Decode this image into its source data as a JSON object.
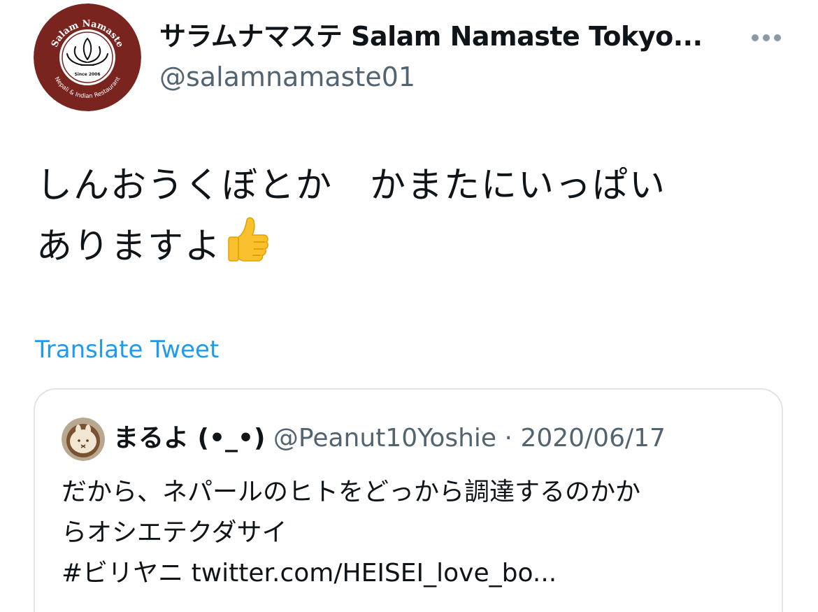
{
  "tweet": {
    "author": {
      "display_name": "サラムナマステ Salam Namaste Tokyo...",
      "handle": "@salamnamaste01",
      "avatar": {
        "icon": "salam-namaste-logo",
        "logo_top_text": "Salam Namaste",
        "logo_since": "Since 2006",
        "logo_bottom_text": "Nepali & Indian Restaurant",
        "color": "#7a2420"
      }
    },
    "text_lines": [
      "しんおうくぼとか　かまたにいっぱい",
      "ありますよ"
    ],
    "emoji": "thumbs-up-icon",
    "translate_label": "Translate Tweet",
    "more_icon": "more-dots-icon"
  },
  "quote": {
    "display_name": "まるよ (•_•)",
    "handle": "@Peanut10Yoshie",
    "separator": "·",
    "date": "2020/06/17",
    "avatar_icon": "latte-art-avatar",
    "text_lines": [
      "だから、ネパールのヒトをどっから調達するのかか",
      "らオシエテクダサイ",
      "#ビリヤニ twitter.com/HEISEI_love_bo..."
    ]
  },
  "colors": {
    "link": "#1d9bf0",
    "secondary_text": "#536471",
    "border": "#dfe4e8",
    "brand_maroon": "#7a2420"
  }
}
